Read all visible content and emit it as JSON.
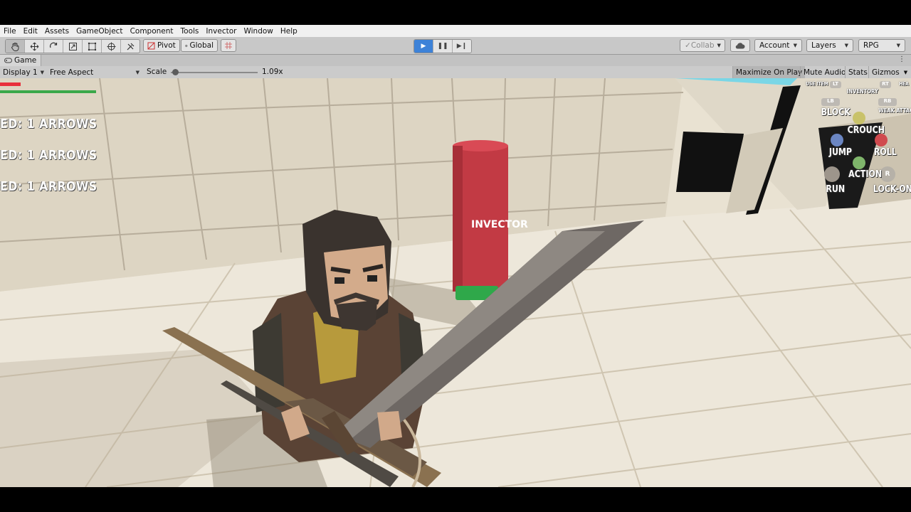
{
  "menu": [
    "File",
    "Edit",
    "Assets",
    "GameObject",
    "Component",
    "Tools",
    "Invector",
    "Window",
    "Help"
  ],
  "toolbar": {
    "tools": [
      "hand-icon",
      "move-icon",
      "rotate-icon",
      "scale-icon",
      "rect-icon",
      "transform-icon",
      "custom-tool-icon"
    ],
    "pivot_label": "Pivot",
    "global_label": "Global",
    "collab_label": "Collab",
    "account_label": "Account",
    "layers_label": "Layers",
    "layout_label": "RPG",
    "play_active": true
  },
  "game_tab": {
    "title": "Game",
    "display": "Display 1",
    "aspect": "Free Aspect",
    "scale_label": "Scale",
    "scale_value": "1.09x",
    "scale_fraction": 0.05,
    "maximize": "Maximize On Play",
    "mute": "Mute Audio",
    "stats": "Stats",
    "gizmos": "Gizmos"
  },
  "hud": {
    "messages": [
      "ED: 1 ARROWS",
      "ED: 1 ARROWS",
      "ED: 1 ARROWS"
    ],
    "health_fraction": 0.22,
    "stamina_fraction": 1.0,
    "health_color": "#e8303c",
    "stamina_color": "#3aa84a"
  },
  "target_dummy": {
    "logo": "INVECTOR"
  },
  "controls": {
    "use_item": "USE ITEM",
    "inventory": "INVENTORY",
    "heavy": "HEA",
    "lt": "LT",
    "lb": "LB",
    "rb": "RB",
    "block": "BLOCK",
    "weak_attack": "WEAK ATTACK",
    "crouch": "CROUCH",
    "jump": "JUMP",
    "roll": "ROLL",
    "action": "ACTION",
    "run": "RUN",
    "lock_on": "LOCK-ON",
    "r": "R"
  }
}
